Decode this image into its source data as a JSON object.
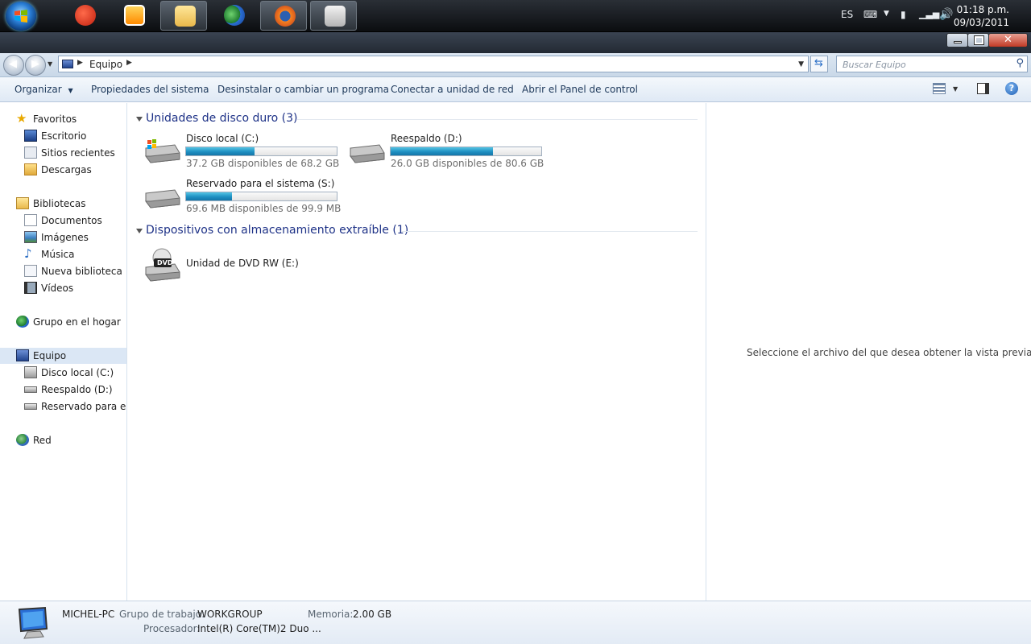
{
  "taskbar": {
    "items": [
      "ccleaner",
      "media-player",
      "windows-explorer",
      "messenger",
      "firefox",
      "kaspersky"
    ],
    "language": "ES",
    "time": "01:18 p.m.",
    "date": "09/03/2011"
  },
  "address": {
    "crumb": "Equipo",
    "search_placeholder": "Buscar Equipo"
  },
  "commands": [
    "Organizar",
    "Propiedades del sistema",
    "Desinstalar o cambiar un programa",
    "Conectar a unidad de red",
    "Abrir el Panel de control"
  ],
  "nav": {
    "favorites": "Favoritos",
    "favorites_items": [
      "Escritorio",
      "Sitios recientes",
      "Descargas"
    ],
    "libraries": "Bibliotecas",
    "libraries_items": [
      "Documentos",
      "Imágenes",
      "Música",
      "Nueva biblioteca",
      "Vídeos"
    ],
    "homegroup": "Grupo en el hogar",
    "computer": "Equipo",
    "computer_items": [
      "Disco local (C:)",
      "Reespaldo (D:)",
      "Reservado para el sistema (S:)"
    ],
    "network": "Red"
  },
  "groups": {
    "hdd_title": "Unidades de disco duro (3)",
    "removable_title": "Dispositivos con almacenamiento extraíble (1)"
  },
  "drives": [
    {
      "name": "Disco local (C:)",
      "free": "37.2 GB disponibles de 68.2 GB",
      "used_fraction": 0.455
    },
    {
      "name": "Reespaldo (D:)",
      "free": "26.0 GB disponibles de 80.6 GB",
      "used_fraction": 0.677
    },
    {
      "name": "Reservado para el sistema (S:)",
      "free": "69.6 MB disponibles de 99.9 MB",
      "used_fraction": 0.303
    }
  ],
  "removable": [
    {
      "name": "Unidad de DVD RW (E:)",
      "label": "DVD"
    }
  ],
  "preview": {
    "message": "Seleccione el archivo del que desea obtener la vista previa."
  },
  "details": {
    "computer_name": "MICHEL-PC",
    "workgroup_label": "Grupo de trabajo:",
    "workgroup_value": "WORKGROUP",
    "memory_label": "Memoria:",
    "memory_value": "2.00 GB",
    "processor_label": "Procesador:",
    "processor_value": "Intel(R) Core(TM)2 Duo ..."
  },
  "colors": {
    "accent": "#1e3287",
    "bar_fill": "#1f8fc2"
  }
}
